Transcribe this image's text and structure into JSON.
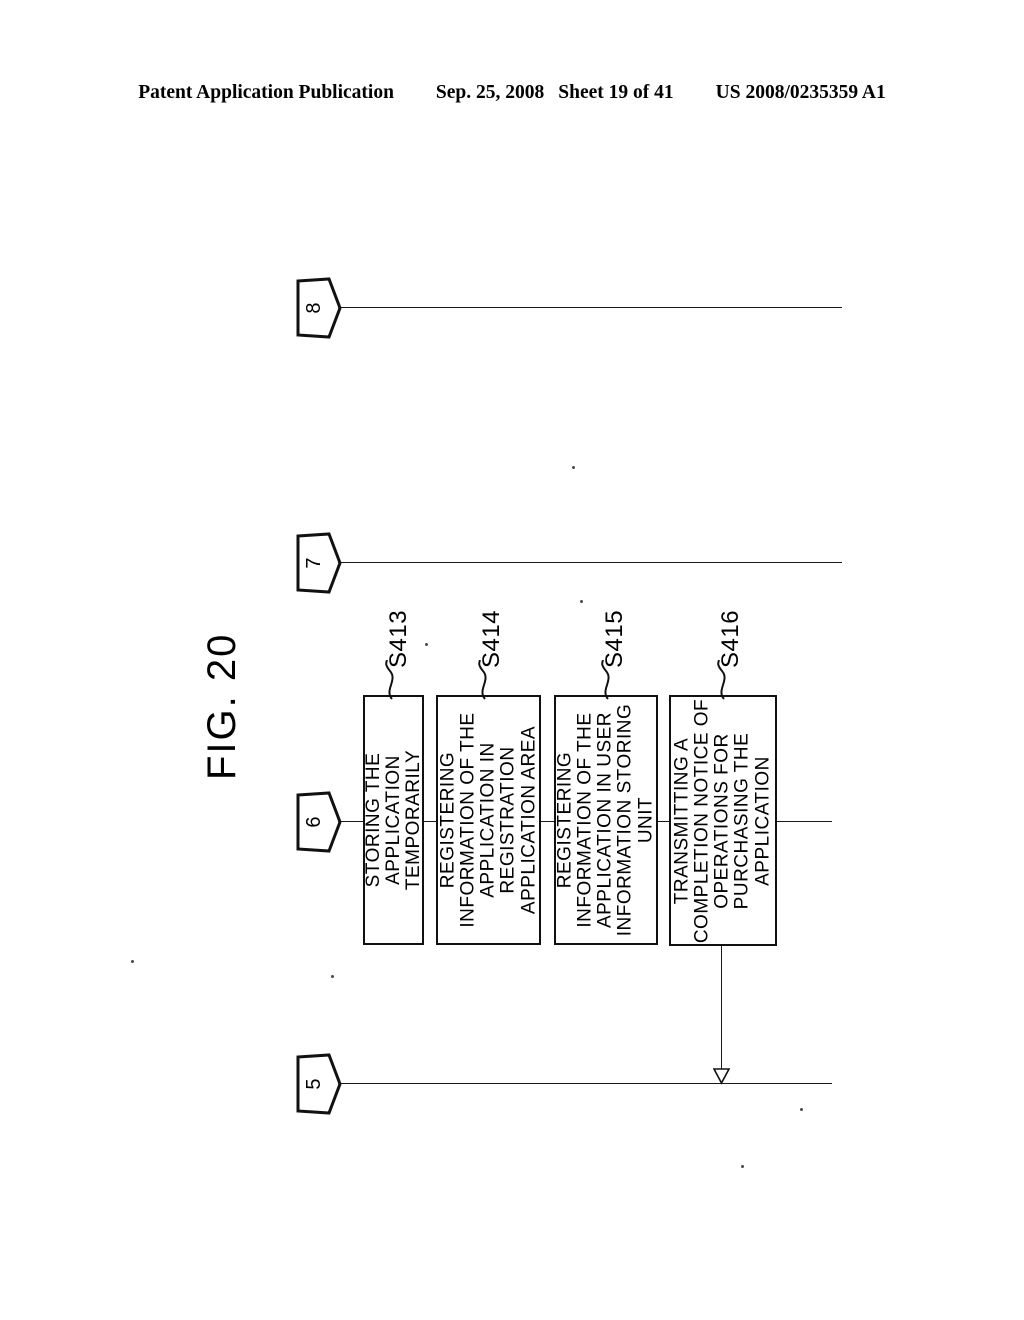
{
  "header": {
    "publication": "Patent Application Publication",
    "date": "Sep. 25, 2008",
    "sheet": "Sheet 19 of 41",
    "number": "US 2008/0235359 A1"
  },
  "figure": {
    "title": "FIG. 20",
    "connectors": [
      {
        "id": "connector-8",
        "label": "8"
      },
      {
        "id": "connector-7",
        "label": "7"
      },
      {
        "id": "connector-6",
        "label": "6"
      },
      {
        "id": "connector-5",
        "label": "5"
      }
    ],
    "steps": [
      {
        "id": "step-s413",
        "number": "S413",
        "lines": [
          "STORING THE",
          "APPLICATION",
          "TEMPORARILY"
        ]
      },
      {
        "id": "step-s414",
        "number": "S414",
        "lines": [
          "REGISTERING",
          "INFORMATION OF THE",
          "APPLICATION IN",
          "REGISTRATION",
          "APPLICATION AREA"
        ]
      },
      {
        "id": "step-s415",
        "number": "S415",
        "lines": [
          "REGISTERING",
          "INFORMATION OF THE",
          "APPLICATION IN USER",
          "INFORMATION STORING",
          "UNIT"
        ]
      },
      {
        "id": "step-s416",
        "number": "S416",
        "lines": [
          "TRANSMITTING A",
          "COMPLETION NOTICE OF",
          "OPERATIONS FOR",
          "PURCHASING THE",
          "APPLICATION"
        ]
      }
    ]
  }
}
